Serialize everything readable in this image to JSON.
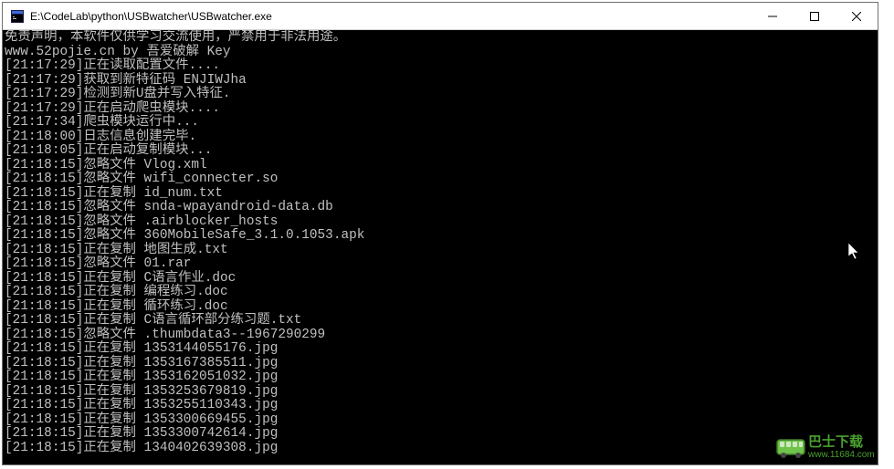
{
  "window": {
    "title": "E:\\CodeLab\\python\\USBwatcher\\USBwatcher.exe"
  },
  "terminal": {
    "lines": [
      "免责声明，本软件仅供学习交流使用，严禁用于非法用途。",
      "www.52pojie.cn by 吾爱破解 Key",
      "[21:17:29]正在读取配置文件....",
      "[21:17:29]获取到新特征码 ENJIWJha",
      "[21:17:29]检测到新U盘并写入特征.",
      "[21:17:29]正在启动爬虫模块....",
      "[21:17:34]爬虫模块运行中...",
      "[21:18:00]日志信息创建完毕.",
      "[21:18:05]正在启动复制模块...",
      "[21:18:15]忽略文件 Vlog.xml",
      "[21:18:15]忽略文件 wifi_connecter.so",
      "[21:18:15]正在复制 id_num.txt",
      "[21:18:15]忽略文件 snda-wpayandroid-data.db",
      "[21:18:15]忽略文件 .airblocker_hosts",
      "[21:18:15]忽略文件 360MobileSafe_3.1.0.1053.apk",
      "[21:18:15]正在复制 地图生成.txt",
      "[21:18:15]忽略文件 01.rar",
      "[21:18:15]正在复制 C语言作业.doc",
      "[21:18:15]正在复制 编程练习.doc",
      "[21:18:15]正在复制 循环练习.doc",
      "[21:18:15]正在复制 C语言循环部分练习题.txt",
      "[21:18:15]忽略文件 .thumbdata3--1967290299",
      "[21:18:15]正在复制 1353144055176.jpg",
      "[21:18:15]正在复制 1353167385511.jpg",
      "[21:18:15]正在复制 1353162051032.jpg",
      "[21:18:15]正在复制 1353253679819.jpg",
      "[21:18:15]正在复制 1353255110343.jpg",
      "[21:18:15]正在复制 1353300669455.jpg",
      "[21:18:15]正在复制 1353300742614.jpg",
      "[21:18:15]正在复制 1340402639308.jpg"
    ]
  },
  "watermark": {
    "label": "巴士下载",
    "url": "www.11684.com"
  }
}
